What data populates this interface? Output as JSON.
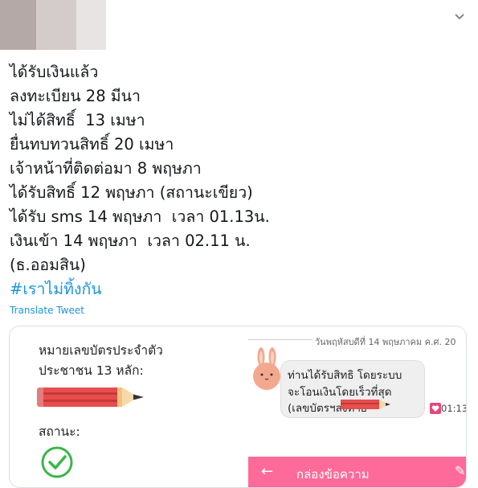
{
  "tweet": {
    "lines": [
      "ได้รับเงินแล้ว",
      "ลงทะเบียน 28 มีนา",
      "ไม่ได้สิทธิ์  13 เมษา",
      "ยื่นทบทวนสิทธิ์ 20 เมษา",
      "เจ้าหน้าที่ติดต่อมา 8 พฤษภา",
      "ได้รับสิทธิ์ 12 พฤษภา (สถานะเขียว)",
      "ได้รับ sms 14 พฤษภา  เวลา 01.13น.",
      "เงินเข้า 14 พฤษภา  เวลา 02.11 น.",
      "(ธ.ออมสิน)"
    ],
    "hashtag": "#เราไม่ทิ้งกัน",
    "translate_label": "Translate Tweet"
  },
  "card": {
    "left": {
      "id_label_1": "หมายเลขบัตรประจำตัว",
      "id_label_2": "ประชาชน 13 หลัก:",
      "status_label": "สถานะ:"
    },
    "right": {
      "date": "วันพฤหัสบดีที่ 14 พฤษภาคม ค.ศ. 20",
      "message_1": "ท่านได้รับสิทธิ โดยระบบ",
      "message_2": "จะโอนเงินโดยเร็วที่สุด",
      "message_3": "(เลขบัตรฯลงท้าย",
      "time": "01:13",
      "inbox_title": "กล่องข้อความ"
    }
  },
  "colors": {
    "link": "#1b95e0",
    "pink_bar": "#fe6a9a",
    "pencil_red": "#e74d4d",
    "check_green": "#3bb54a"
  },
  "icons": [
    "chevron-down-icon",
    "pencil-redaction-icon",
    "check-circle-icon",
    "bunny-icon",
    "heart-icon",
    "back-arrow-icon",
    "pen-icon"
  ]
}
